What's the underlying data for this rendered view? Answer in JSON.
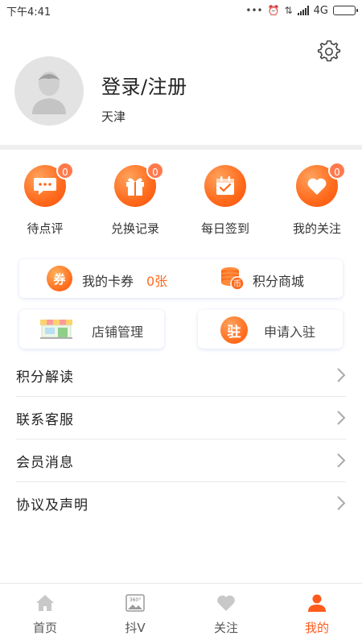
{
  "status_bar": {
    "time": "下午4:41",
    "network": "4G"
  },
  "profile": {
    "login_label": "登录/注册",
    "city": "天津"
  },
  "quick_actions": [
    {
      "label": "待点评",
      "badge": "0",
      "icon": "comment-icon"
    },
    {
      "label": "兑换记录",
      "badge": "0",
      "icon": "gift-icon"
    },
    {
      "label": "每日签到",
      "badge": "",
      "icon": "calendar-check-icon"
    },
    {
      "label": "我的关注",
      "badge": "0",
      "icon": "heart-icon"
    }
  ],
  "cards": {
    "coupon_icon_text": "券",
    "coupon_label": "我的卡券",
    "coupon_count": "0张",
    "mall_label": "积分商城",
    "store_label": "店铺管理",
    "join_icon_text": "驻",
    "join_label": "申请入驻"
  },
  "menu": [
    {
      "label": "积分解读"
    },
    {
      "label": "联系客服"
    },
    {
      "label": "会员消息"
    },
    {
      "label": "协议及声明"
    }
  ],
  "tabs": [
    {
      "label": "首页",
      "icon": "home-icon"
    },
    {
      "label": "抖V",
      "icon": "photo-360-icon"
    },
    {
      "label": "关注",
      "icon": "heart-icon"
    },
    {
      "label": "我的",
      "icon": "user-icon",
      "active": true
    }
  ],
  "colors": {
    "accent": "#ff6a1c",
    "badge": "#ff7a4d",
    "tab_active": "#ff5a1c",
    "tab_inactive": "#c8c8c8"
  }
}
